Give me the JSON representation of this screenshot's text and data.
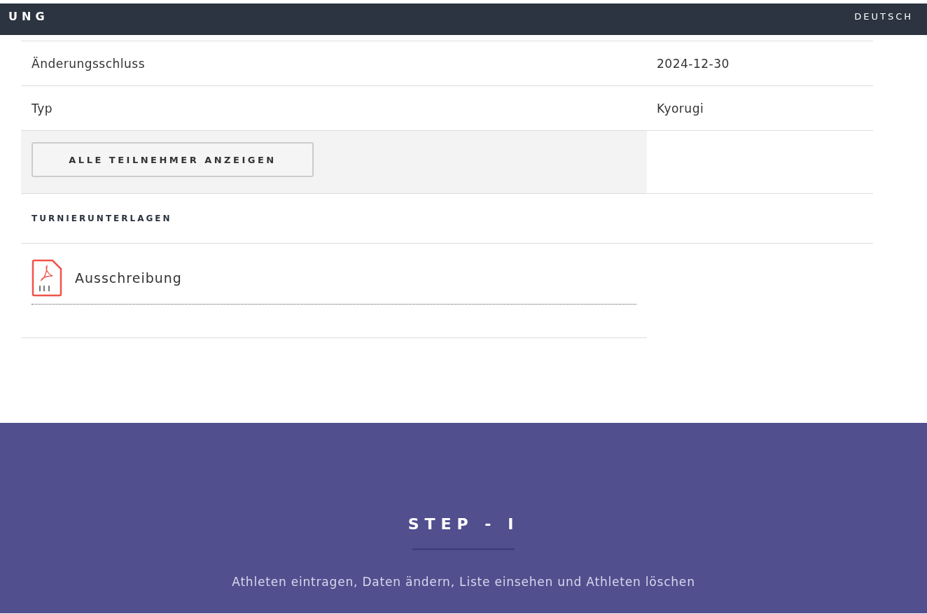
{
  "header": {
    "title": "UNG",
    "language": "DEUTSCH"
  },
  "details": [
    {
      "label": "Änderungsschluss",
      "value": "2024-12-30"
    },
    {
      "label": "Typ",
      "value": "Kyorugi"
    }
  ],
  "participants_button": "ALLE TEILNEHMER ANZEIGEN",
  "documents": {
    "heading": "TURNIERUNTERLAGEN",
    "files": [
      {
        "kind": "pdf",
        "name": "Ausschreibung"
      }
    ]
  },
  "step": {
    "title": "STEP - I",
    "description": "Athleten eintragen, Daten ändern, Liste einsehen und Athleten löschen"
  }
}
